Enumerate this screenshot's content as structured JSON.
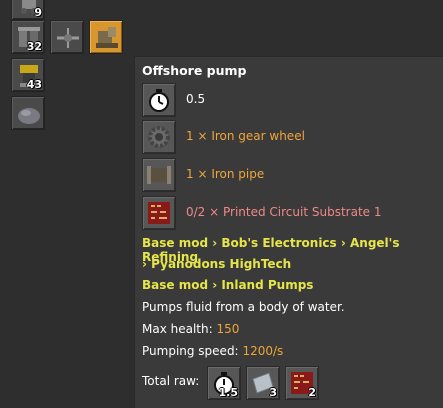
{
  "inventory": {
    "counts": [
      "9",
      "32",
      "43"
    ]
  },
  "tooltip": {
    "title": "Offshore pump",
    "time": "0.5",
    "ingredients": [
      {
        "icon": "gear-icon",
        "text": "1 × Iron gear wheel"
      },
      {
        "icon": "pipe-icon",
        "text": "1 × Iron pipe"
      },
      {
        "icon": "circuit-icon",
        "text": "0/2 × Printed Circuit Substrate 1"
      }
    ],
    "mods_line1": "Base mod › Bob's Electronics › Angel's Refining",
    "mods_line2": "› Pyanodons HighTech",
    "mods_line3": "Base mod › Inland Pumps",
    "description": "Pumps fluid from a body of water.",
    "max_health_label": "Max health:",
    "max_health_value": "150",
    "pumping_speed_label": "Pumping speed:",
    "pumping_speed_value": "1200/s",
    "total_raw_label": "Total raw:",
    "raw_counts": [
      "1.5",
      "3",
      "2"
    ]
  },
  "colors": {
    "highlight": "#d8962f",
    "ingredient_available": "#f0a53a",
    "ingredient_missing": "#f08888",
    "mod_text": "#e6e64a"
  }
}
